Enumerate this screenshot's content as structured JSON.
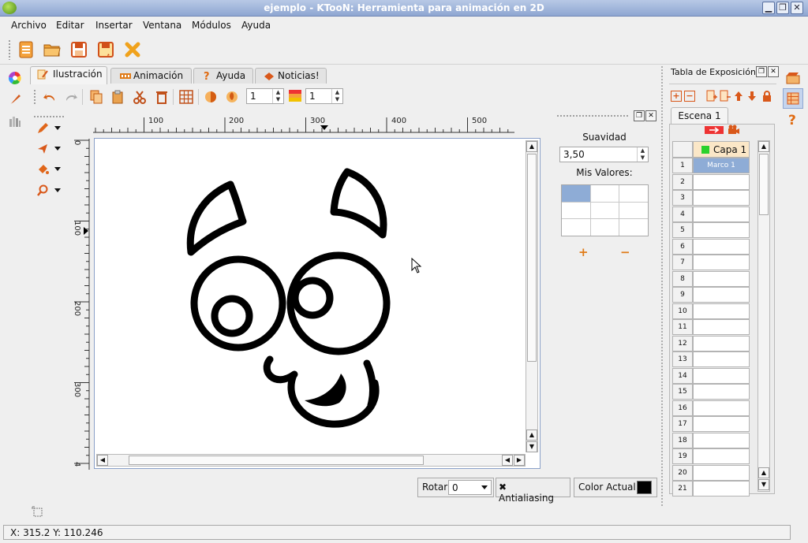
{
  "window": {
    "title": "ejemplo - KTooN: Herramienta para animación en 2D"
  },
  "menu": [
    "Archivo",
    "Editar",
    "Insertar",
    "Ventana",
    "Módulos",
    "Ayuda"
  ],
  "tabs": [
    {
      "label": "Ilustración"
    },
    {
      "label": "Animación"
    },
    {
      "label": "Ayuda"
    },
    {
      "label": "Noticias!"
    }
  ],
  "toolbar2": {
    "spin1_value": "1",
    "spin2_value": "1"
  },
  "ruler": {
    "h_ticks": [
      "100",
      "200",
      "300",
      "400",
      "500"
    ],
    "v_ticks": [
      "0",
      "100",
      "200",
      "300",
      "4"
    ]
  },
  "smoothing": {
    "label": "Suavidad",
    "value": "3,50",
    "my_values_label": "Mis Valores:",
    "plus": "+",
    "minus": "−"
  },
  "bottom": {
    "rotate_label": "Rotar",
    "rotate_value": "0",
    "antialias_label": "Antialiasing",
    "color_label": "Color Actual",
    "current_color": "#000000"
  },
  "exposure": {
    "title": "Tabla de Exposición",
    "scene_tab": "Escena 1",
    "layer_name": "Capa 1",
    "layer_color": "#2bd12b",
    "first_frame": "Marco 1",
    "rows": [
      "1",
      "2",
      "3",
      "4",
      "5",
      "6",
      "7",
      "8",
      "9",
      "10",
      "11",
      "12",
      "13",
      "14",
      "15",
      "16",
      "17",
      "18",
      "19",
      "20",
      "21"
    ]
  },
  "status": {
    "coords": "X: 315.2 Y: 110.246"
  },
  "colors": {
    "selection": "#8eacd6",
    "accent_orange": "#e07b18"
  }
}
